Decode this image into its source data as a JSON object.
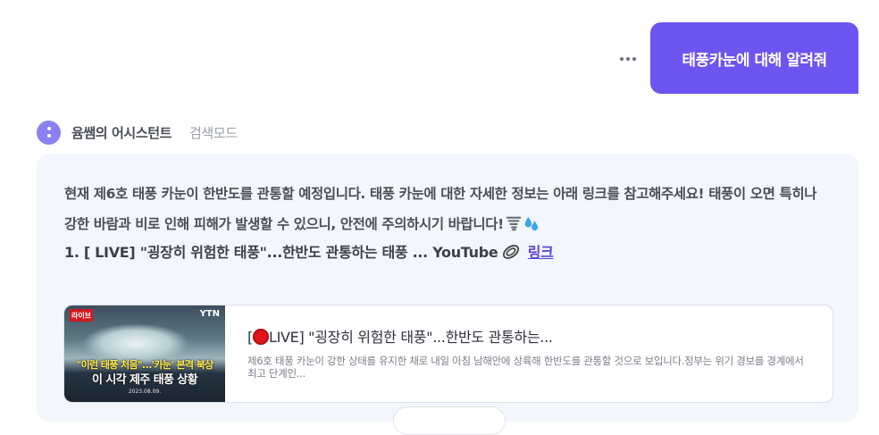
{
  "user_message": "태풍카눈에 대해 알려줘",
  "assistant": {
    "name": "윰쌤의 어시스턴트",
    "mode": "검색모드"
  },
  "answer": {
    "text": "현재 제6호 태풍 카눈이 한반도를 관통할 예정입니다. 태풍 카눈에 대한 자세한 정보는 아래 링크를 참고해주세요! 태풍이 오면 특히나 강한 바람과 비로 인해 피해가 발생할 수 있으니, 안전에 주의하시기 바랍니다!",
    "emojis": [
      "tornado-icon",
      "droplets-icon"
    ],
    "list_item": "1. [ LIVE] \"굉장히 위험한 태풍\"...한반도 관통하는 태풍 ... YouTube",
    "link_label": "링크"
  },
  "card": {
    "title_prefix": "[",
    "title": "LIVE] \"굉장히 위험한 태풍\"...한반도 관통하는...",
    "description": "제6호 태풍 카눈이 강한 상태를 유지한 채로 내일 아침 남해안에 상륙해 한반도를 관통할 것으로 보입니다.정부는 위기 경보를 경계에서 최고 단계인...",
    "thumbnail": {
      "channel_badge": "라이브",
      "brand": "YTN",
      "caption_line1": "\"이런 태풍 처음\"…'카눈' 본격 북상",
      "caption_line2": "이 시각 제주 태풍 상황",
      "date": "2023.08.09."
    }
  },
  "colors": {
    "accent": "#6d55f0",
    "bubble_bg": "#f4f6fd",
    "link": "#5b3fd8"
  }
}
